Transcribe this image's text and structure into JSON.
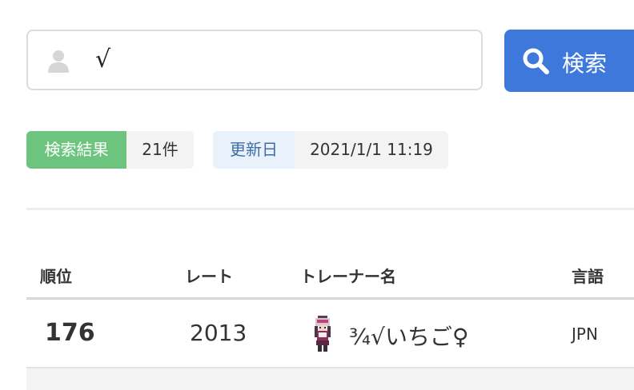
{
  "search": {
    "value": "√"
  },
  "search_button": {
    "label": "検索"
  },
  "tags": {
    "results": {
      "key": "検索結果",
      "value": "21件"
    },
    "updated": {
      "key": "更新日",
      "value": "2021/1/1 11:19"
    }
  },
  "table": {
    "headers": {
      "rank": "順位",
      "rate": "レート",
      "trainer": "トレーナー名",
      "lang": "言語"
    },
    "rows": [
      {
        "rank": "176",
        "rate": "2013",
        "trainer": "¾√いちご♀",
        "lang": "JPN"
      }
    ]
  }
}
